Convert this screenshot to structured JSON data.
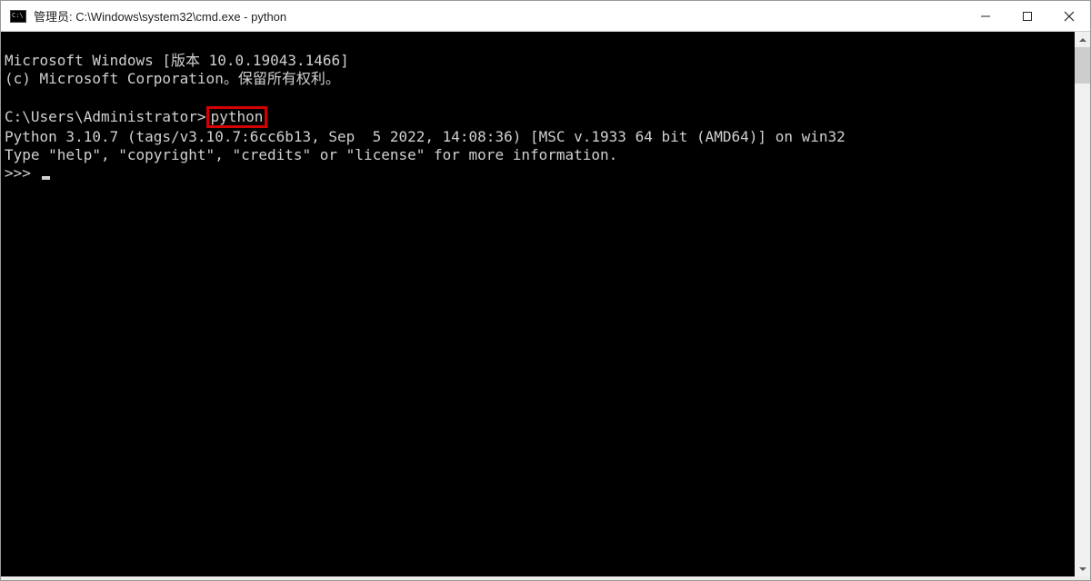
{
  "titlebar": {
    "title": "管理员: C:\\Windows\\system32\\cmd.exe - python"
  },
  "terminal": {
    "line1": "Microsoft Windows [版本 10.0.19043.1466]",
    "line2": "(c) Microsoft Corporation。保留所有权利。",
    "blank1": "",
    "prompt_line_prefix": "C:\\Users\\Administrator>",
    "prompt_command": "python",
    "py_version": "Python 3.10.7 (tags/v3.10.7:6cc6b13, Sep  5 2022, 14:08:36) [MSC v.1933 64 bit (AMD64)] on win32",
    "py_help": "Type \"help\", \"copyright\", \"credits\" or \"license\" for more information.",
    "py_prompt": ">>> "
  }
}
